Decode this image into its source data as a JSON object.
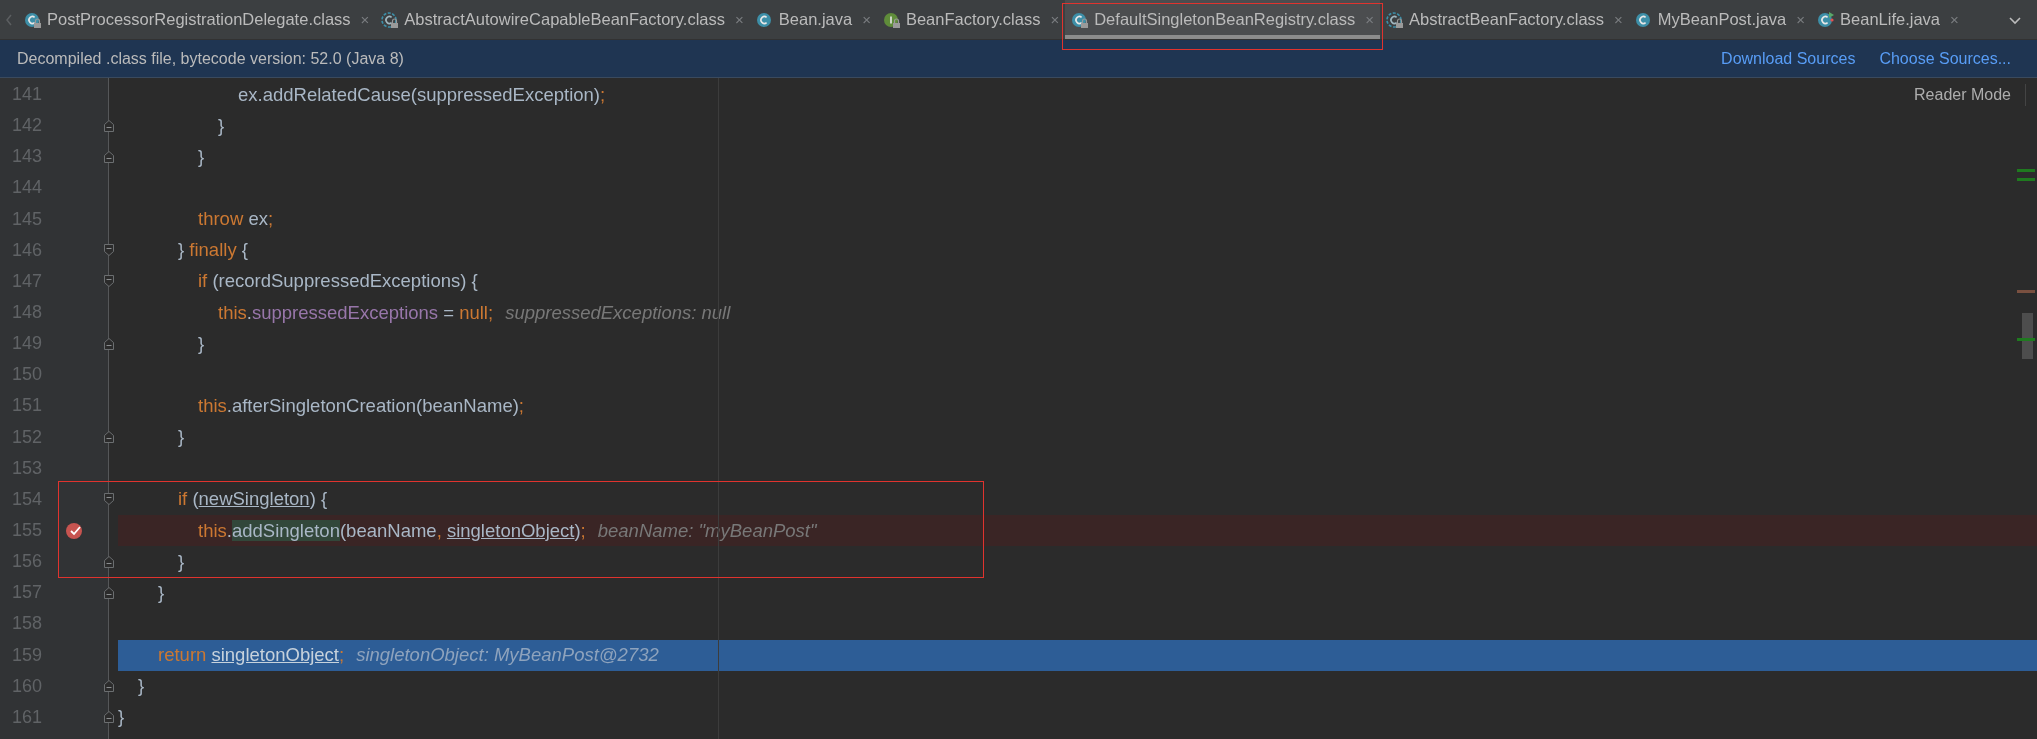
{
  "tabs": [
    {
      "label": "PostProcessorRegistrationDelegate.class",
      "kind": "class",
      "locked": true,
      "selected": false,
      "boxed": false,
      "close": "×"
    },
    {
      "label": "AbstractAutowireCapableBeanFactory.class",
      "kind": "abstract",
      "locked": true,
      "selected": false,
      "boxed": false,
      "close": "×"
    },
    {
      "label": "Bean.java",
      "kind": "class",
      "locked": false,
      "selected": false,
      "boxed": false,
      "close": "×"
    },
    {
      "label": "BeanFactory.class",
      "kind": "interface",
      "locked": true,
      "selected": false,
      "boxed": false,
      "close": "×"
    },
    {
      "label": "DefaultSingletonBeanRegistry.class",
      "kind": "class",
      "locked": true,
      "selected": true,
      "boxed": true,
      "close": "×"
    },
    {
      "label": "AbstractBeanFactory.class",
      "kind": "abstract",
      "locked": true,
      "selected": false,
      "boxed": false,
      "close": "×"
    },
    {
      "label": "MyBeanPost.java",
      "kind": "class",
      "locked": false,
      "selected": false,
      "boxed": false,
      "close": "×"
    },
    {
      "label": "BeanLife.java",
      "kind": "runnable",
      "locked": false,
      "selected": false,
      "boxed": false,
      "close": "×"
    }
  ],
  "notice": {
    "message": "Decompiled .class file, bytecode version: 52.0 (Java 8)",
    "links": [
      "Download Sources",
      "Choose Sources..."
    ]
  },
  "editor": {
    "reader_mode": "Reader Mode",
    "lines": [
      {
        "children": [
          {
            "children": [
              {
                "children": [
                  {
                    "children": [
                      {
                        "children": [
                          {
                            "children": [
                              {
                                "number": "141",
                                "breakpoint": false,
                                "execution": false,
                                "boxed": false,
                                "tokens": [
                                  {
                                    "text": "ex.addRelatedCause(suppressedException)",
                                    "kind": "plain"
                                  },
                                  {
                                    "text": ";",
                                    "kind": "punct"
                                  }
                                ]
                              }
                            ]
                          },
                          {
                            "number": "142",
                            "fold": {
                              "kind": "end"
                            },
                            "breakpoint": false,
                            "execution": false,
                            "boxed": false,
                            "tokens": [
                              {
                                "text": "}",
                                "kind": "plain"
                              }
                            ]
                          }
                        ]
                      },
                      {
                        "number": "143",
                        "fold": {
                          "kind": "end"
                        },
                        "breakpoint": false,
                        "execution": false,
                        "boxed": false,
                        "tokens": [
                          {
                            "text": "}",
                            "kind": "plain"
                          }
                        ]
                      },
                      {
                        "number": "144",
                        "breakpoint": false,
                        "execution": false,
                        "boxed": false
                      },
                      {
                        "number": "145",
                        "breakpoint": false,
                        "execution": false,
                        "boxed": false,
                        "tokens": [
                          {
                            "text": "throw",
                            "kind": "keyword"
                          },
                          {
                            "text": " ex",
                            "kind": "plain"
                          },
                          {
                            "text": ";",
                            "kind": "punct"
                          }
                        ]
                      }
                    ]
                  },
                  {
                    "number": "146",
                    "fold": {
                      "kind": "start"
                    },
                    "breakpoint": false,
                    "execution": false,
                    "boxed": false,
                    "tokens": [
                      {
                        "text": "} ",
                        "kind": "plain"
                      },
                      {
                        "text": "finally",
                        "kind": "keyword"
                      },
                      {
                        "text": " {",
                        "kind": "plain"
                      }
                    ]
                  },
                  {
                    "children": [
                      {
                        "number": "147",
                        "fold": {
                          "kind": "start"
                        },
                        "breakpoint": false,
                        "execution": false,
                        "boxed": false,
                        "tokens": [
                          {
                            "text": "if",
                            "kind": "keyword"
                          },
                          {
                            "text": " (recordSuppressedExceptions) {",
                            "kind": "plain"
                          }
                        ]
                      },
                      {
                        "children": [
                          {
                            "number": "148",
                            "breakpoint": false,
                            "execution": false,
                            "boxed": false,
                            "tokens": [
                              {
                                "text": "this",
                                "kind": "keyword"
                              },
                              {
                                "text": ".",
                                "kind": "plain"
                              },
                              {
                                "text": "suppressedExceptions",
                                "kind": "field"
                              },
                              {
                                "text": " = ",
                                "kind": "plain"
                              },
                              {
                                "text": "null",
                                "kind": "keyword"
                              },
                              {
                                "text": ";",
                                "kind": "punct"
                              }
                            ],
                            "hint": "suppressedExceptions: null"
                          }
                        ]
                      },
                      {
                        "number": "149",
                        "fold": {
                          "kind": "end"
                        },
                        "breakpoint": false,
                        "execution": false,
                        "boxed": false,
                        "tokens": [
                          {
                            "text": "}",
                            "kind": "plain"
                          }
                        ]
                      },
                      {
                        "number": "150",
                        "breakpoint": false,
                        "execution": false,
                        "boxed": false
                      },
                      {
                        "number": "151",
                        "breakpoint": false,
                        "execution": false,
                        "boxed": false,
                        "tokens": [
                          {
                            "text": "this",
                            "kind": "keyword"
                          },
                          {
                            "text": ".afterSingletonCreation(beanName)",
                            "kind": "plain"
                          },
                          {
                            "text": ";",
                            "kind": "punct"
                          }
                        ]
                      }
                    ]
                  },
                  {
                    "number": "152",
                    "fold": {
                      "kind": "end"
                    },
                    "breakpoint": false,
                    "execution": false,
                    "boxed": false,
                    "tokens": [
                      {
                        "text": "}",
                        "kind": "plain"
                      }
                    ]
                  },
                  {
                    "number": "153",
                    "breakpoint": false,
                    "execution": false,
                    "boxed": false
                  },
                  {
                    "number": "154",
                    "fold": {
                      "kind": "start"
                    },
                    "breakpoint": false,
                    "execution": false,
                    "boxed": true,
                    "tokens": [
                      {
                        "text": "if",
                        "kind": "keyword"
                      },
                      {
                        "text": " (",
                        "kind": "plain"
                      },
                      {
                        "text": "newSingleton",
                        "kind": "local"
                      },
                      {
                        "text": ") {",
                        "kind": "plain"
                      }
                    ]
                  },
                  {
                    "children": [
                      {
                        "number": "155",
                        "breakpoint": true,
                        "execution": false,
                        "boxed": true,
                        "tokens": [
                          {
                            "text": "this",
                            "kind": "keyword"
                          },
                          {
                            "text": ".",
                            "kind": "plain"
                          },
                          {
                            "text": "addSingleton",
                            "kind": "match"
                          },
                          {
                            "text": "(beanName",
                            "kind": "plain"
                          },
                          {
                            "text": ", ",
                            "kind": "punct"
                          },
                          {
                            "text": "singletonObject",
                            "kind": "local"
                          },
                          {
                            "text": ")",
                            "kind": "plain"
                          },
                          {
                            "text": ";",
                            "kind": "punct"
                          }
                        ],
                        "hint": "beanName: \"myBeanPost\""
                      }
                    ]
                  },
                  {
                    "number": "156",
                    "fold": {
                      "kind": "end"
                    },
                    "breakpoint": false,
                    "execution": false,
                    "boxed": true,
                    "tokens": [
                      {
                        "text": "}",
                        "kind": "plain"
                      }
                    ]
                  }
                ]
              },
              {
                "number": "157",
                "fold": {
                  "kind": "end"
                },
                "breakpoint": false,
                "execution": false,
                "boxed": false,
                "tokens": [
                  {
                    "text": "}",
                    "kind": "plain"
                  }
                ]
              },
              {
                "number": "158",
                "breakpoint": false,
                "execution": false,
                "boxed": false
              },
              {
                "number": "159",
                "breakpoint": false,
                "execution": true,
                "boxed": false,
                "tokens": [
                  {
                    "text": "return ",
                    "kind": "keyword"
                  },
                  {
                    "text": "singletonObject",
                    "kind": "local"
                  },
                  {
                    "text": ";",
                    "kind": "punct"
                  }
                ],
                "hint": "singletonObject: MyBeanPost@2732"
              }
            ]
          },
          {
            "number": "160",
            "fold": {
              "kind": "end"
            },
            "breakpoint": false,
            "execution": false,
            "boxed": false,
            "tokens": [
              {
                "text": "}",
                "kind": "plain"
              }
            ]
          }
        ]
      },
      {
        "number": "161",
        "fold": {
          "kind": "end"
        },
        "breakpoint": false,
        "execution": false,
        "boxed": false,
        "tokens": [
          {
            "text": "}",
            "kind": "plain"
          }
        ]
      }
    ]
  }
}
